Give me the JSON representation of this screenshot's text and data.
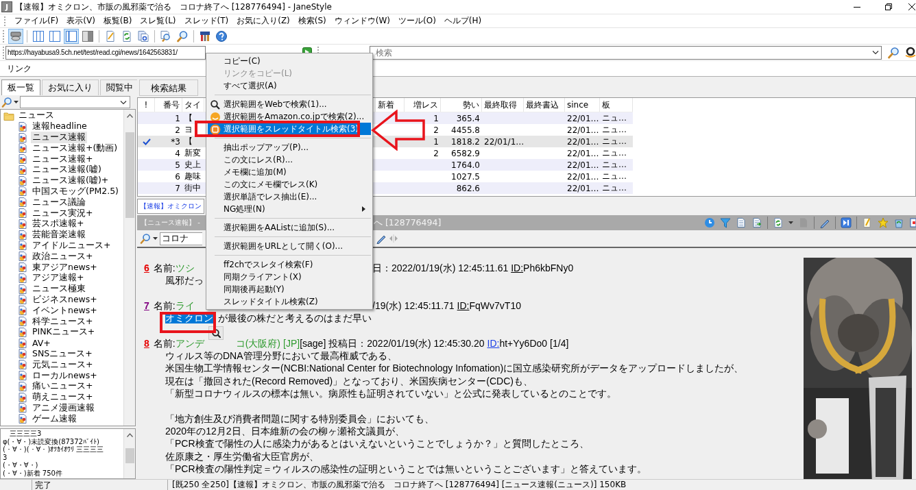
{
  "window": {
    "icon_letter": "J",
    "title": "【速報】オミクロン、市販の風邪薬で治る　コロナ終了へ  [128776494] - JaneStyle"
  },
  "menu_bar": [
    "ファイル(F)",
    "表示(V)",
    "板覧(B)",
    "スレ覧(L)",
    "スレッド(T)",
    "お気に入り(Z)",
    "検索(S)",
    "ウィンドウ(W)",
    "ツール(O)",
    "ヘルプ(H)"
  ],
  "toolbar": [
    {
      "kind": "button",
      "pressed": true
    },
    {
      "kind": "separator"
    },
    {
      "kind": "button",
      "pressed": false
    },
    {
      "kind": "button",
      "pressed": false
    },
    {
      "kind": "button",
      "pressed": true
    },
    {
      "kind": "button",
      "pressed": false
    },
    {
      "kind": "separator"
    },
    {
      "kind": "button",
      "pressed": false
    },
    {
      "kind": "button",
      "pressed": false
    },
    {
      "kind": "button",
      "pressed": false
    },
    {
      "kind": "separator"
    },
    {
      "kind": "button",
      "pressed": false
    },
    {
      "kind": "button",
      "pressed": false
    },
    {
      "kind": "separator"
    },
    {
      "kind": "button",
      "pressed": false
    },
    {
      "kind": "button",
      "pressed": false
    }
  ],
  "address": {
    "url": "https://hayabusa9.5ch.net/test/read.cgi/news/1642563831/",
    "search_placeholder": "検索"
  },
  "link_bar": {
    "label": "リンク"
  },
  "board_tabs": [
    {
      "label": "板一覧",
      "selected": true
    },
    {
      "label": "お気に入り",
      "selected": false
    },
    {
      "label": "閲覧中",
      "selected": false
    }
  ],
  "board_tree": [
    {
      "label": "ニュース",
      "expanded": true,
      "children": [
        {
          "label": "速報headline",
          "selected": false
        },
        {
          "label": "ニュース速報",
          "selected": true
        },
        {
          "label": "ニュース速報+(動画)",
          "selected": false
        },
        {
          "label": "ニュース速報+",
          "selected": false
        },
        {
          "label": "ニュース速報(嘘)",
          "selected": false
        },
        {
          "label": "ニュース速報(嘘)+",
          "selected": false
        },
        {
          "label": "中国スモッグ(PM2.5)",
          "selected": false
        },
        {
          "label": "ニュース議論",
          "selected": false
        },
        {
          "label": "ニュース実況+",
          "selected": false
        },
        {
          "label": "芸スポ速報+",
          "selected": false
        },
        {
          "label": "芸能音楽速報",
          "selected": false
        },
        {
          "label": "アイドルニュース+",
          "selected": false
        },
        {
          "label": "政治ニュース+",
          "selected": false
        },
        {
          "label": "東アジアnews+",
          "selected": false
        },
        {
          "label": "アジア速報+",
          "selected": false
        },
        {
          "label": "ニュース極東",
          "selected": false
        },
        {
          "label": "ビジネスnews+",
          "selected": false
        },
        {
          "label": "イベントnews+",
          "selected": false
        },
        {
          "label": "科学ニュース+",
          "selected": false
        },
        {
          "label": "PINKニュース+",
          "selected": false
        },
        {
          "label": "AV+",
          "selected": false
        },
        {
          "label": "SNSニュース+",
          "selected": false
        },
        {
          "label": "元気ニュース+",
          "selected": false
        },
        {
          "label": "ローカルnews+",
          "selected": false
        },
        {
          "label": "痛いニュース+",
          "selected": false
        },
        {
          "label": "萌えニュース+",
          "selected": false
        },
        {
          "label": "アニメ漫画速報",
          "selected": false
        },
        {
          "label": "ゲーム速報",
          "selected": false
        }
      ]
    }
  ],
  "log_lines": [
    "　三三三三3",
    "φ(・∀・)未読変換(87372ﾊﾞｲﾄ)",
    "(・∀・)(・∀・)ｵﾂｶｲｵﾜﾘ 三三三三",
    "3",
    "(・∀・∀・)",
    "(・∀・)新着 750件"
  ],
  "list_tabs": [
    {
      "label": "検索結果",
      "selected": false
    }
  ],
  "thread_list": {
    "columns": [
      "!",
      "番号",
      "タイ",
      "新着",
      "増レス",
      "勢い",
      "最終取得",
      "最終書込",
      "since",
      "板"
    ],
    "rows": [
      {
        "checked": false,
        "selected": false,
        "number": "1",
        "title": "【",
        "increase": "1",
        "momentum": "365.4",
        "since": "22/01…",
        "board": "ニュ…"
      },
      {
        "checked": false,
        "selected": false,
        "number": "2",
        "title": "ヨ",
        "increase": "2",
        "momentum": "4455.8",
        "since": "22/01…",
        "board": "ニュ…"
      },
      {
        "checked": true,
        "selected": true,
        "number": "*3",
        "title": "【",
        "increase": "1",
        "momentum": "1818.2",
        "last_fetched": "22/01/1…",
        "since": "22/01…",
        "board": "ニュ…"
      },
      {
        "checked": false,
        "selected": false,
        "number": "4",
        "title": "新変",
        "increase": "2",
        "momentum": "6582.9",
        "since": "22/01…",
        "board": "ニュ…"
      },
      {
        "checked": false,
        "selected": false,
        "number": "5",
        "title": "史上",
        "momentum": "1764.0",
        "since": "22/01…",
        "board": "ニュ…"
      },
      {
        "checked": false,
        "selected": false,
        "number": "6",
        "title": "趣味",
        "momentum": "1027.5",
        "since": "22/01…",
        "board": "ニュ…"
      },
      {
        "checked": false,
        "selected": false,
        "number": "7",
        "title": "街中",
        "momentum": "862.6",
        "since": "22/01…",
        "board": "ニュ…"
      }
    ]
  },
  "thread_tab": {
    "label": "【速報】オミクロン",
    "selected": true
  },
  "thread_bar": {
    "board": "【ニュース速報】 -",
    "title_tail": "へ [128776494]"
  },
  "thread_search": {
    "value": "コロナ"
  },
  "posts": [
    {
      "number": "6",
      "visited": false,
      "name_label": "名前:",
      "name": "ツシ",
      "date": "日：2022/01/19(水) 12:45:11.61",
      "id_label": "ID:",
      "id": "Ph6kbFNy0",
      "id_link": false,
      "paragraphs": [
        [
          "風邪だっ"
        ]
      ]
    },
    {
      "number": "7",
      "visited": true,
      "name_label": "名前:",
      "name": "ライ",
      "date": "/19(水) 12:45:11.71",
      "id_label": "ID:",
      "id": "FqWv7vT10",
      "id_link": false,
      "selected_text": "オミクロン",
      "paragraphs": [
        [
          "が最後の株だと考えるのはまだ早い"
        ]
      ]
    },
    {
      "number": "8",
      "visited": false,
      "name_label": "名前:",
      "name": "アンデ",
      "name_tail": "コ(大阪府)",
      "region": "[JP]",
      "mail": "[sage]",
      "date": "投稿日：2022/01/19(水) 12:45:30.20",
      "id_label": "ID:",
      "id": "ht+Yy6Do0",
      "id_link": true,
      "count": "[1/4]",
      "paragraphs": [
        [
          "ウィルス等のDNA管理分野において最高権威である、",
          "米国生物工学情報センター(NCBI:National Center for Biotechnology Infomation)に国立感染研究所がデータをアップロードしましたが、",
          "現在は「撤回された(Record Removed)」となっており、米国疾病センター(CDC)も、",
          "「新型コロナウィルスの標本は無い。病原性も証明されていない」と公式に発表しているとのことです。"
        ],
        [
          "「地方創生及び消費者問題に関する特別委員会」においても、",
          "2020年の12月2日、日本維新の会の柳ヶ瀬裕文議員が、",
          "「PCR検査で陽性の人に感染力があるとはいえないということでしょうか？」と質問したところ、",
          "佐原康之・厚生労働省大臣官房が、",
          "「PCR検査の陽性判定＝ウィルスの感染性の証明ということでは無いということございます」と答えています。"
        ]
      ]
    }
  ],
  "ad": {
    "kind": "picture"
  },
  "context_menu": [
    {
      "kind": "item",
      "label": "コピー(C)",
      "disabled": false,
      "selected": false,
      "submenu": false
    },
    {
      "kind": "item",
      "label": "リンクをコピー(L)",
      "disabled": true,
      "selected": false,
      "submenu": false
    },
    {
      "kind": "item",
      "label": "すべて選択(A)",
      "disabled": false,
      "selected": false,
      "submenu": false
    },
    {
      "kind": "separator"
    },
    {
      "kind": "icon-item",
      "label": "選択範囲をWebで検索(1)...",
      "disabled": false,
      "selected": false,
      "submenu": false
    },
    {
      "kind": "icon-item",
      "label": "選択範囲をAmazon.co.jpで検索(2)...",
      "disabled": false,
      "selected": false,
      "submenu": false
    },
    {
      "kind": "icon-item",
      "label": "選択範囲をスレッドタイトル検索(3)",
      "disabled": false,
      "selected": true,
      "submenu": false
    },
    {
      "kind": "separator"
    },
    {
      "kind": "item",
      "label": "抽出ポップアップ(P)...",
      "disabled": false,
      "selected": false,
      "submenu": false
    },
    {
      "kind": "item",
      "label": "この文にレス(R)...",
      "disabled": false,
      "selected": false,
      "submenu": false
    },
    {
      "kind": "item",
      "label": "メモ欄に追加(M)",
      "disabled": false,
      "selected": false,
      "submenu": false
    },
    {
      "kind": "item",
      "label": "この文にメモ欄でレス(K)",
      "disabled": false,
      "selected": false,
      "submenu": false
    },
    {
      "kind": "item",
      "label": "選択単語でレス抽出(E)...",
      "disabled": false,
      "selected": false,
      "submenu": false
    },
    {
      "kind": "item",
      "label": "NG処理(N)",
      "disabled": false,
      "selected": false,
      "submenu": true
    },
    {
      "kind": "separator"
    },
    {
      "kind": "item",
      "label": "選択範囲をAAListに追加(S)...",
      "disabled": false,
      "selected": false,
      "submenu": false
    },
    {
      "kind": "separator"
    },
    {
      "kind": "item",
      "label": "選択範囲をURLとして開く(O)...",
      "disabled": false,
      "selected": false,
      "submenu": false
    },
    {
      "kind": "separator"
    },
    {
      "kind": "item",
      "label": "ff2chでスレタイ検索(F)",
      "disabled": false,
      "selected": false,
      "submenu": false
    },
    {
      "kind": "item",
      "label": "同期クライアント(X)",
      "disabled": false,
      "selected": false,
      "submenu": false
    },
    {
      "kind": "item",
      "label": "同期後再起動(Y)",
      "disabled": false,
      "selected": false,
      "submenu": false
    },
    {
      "kind": "item",
      "label": "スレッドタイトル検索(Z)",
      "disabled": false,
      "selected": false,
      "submenu": false
    }
  ],
  "annotations": [
    {
      "kind": "frame"
    },
    {
      "kind": "arrow"
    },
    {
      "kind": "frame"
    }
  ],
  "status_bar": [
    "完了",
    "[既250 全250]【速報】オミクロン、市販の風邪薬で治る　コロナ終了へ [128776494] [ニュース速報(ニュース)] 150KB"
  ]
}
